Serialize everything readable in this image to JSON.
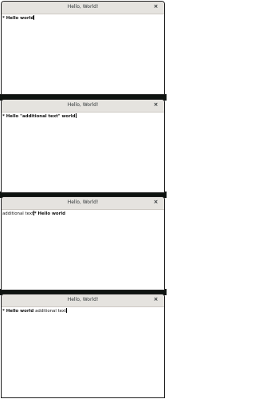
{
  "colors": {
    "titlebar": "#e5e3df",
    "desktop_background": "#0e1310",
    "window_border": "#1f1f1f",
    "text": "#111111"
  },
  "windows": [
    {
      "title": "Hello, World!",
      "close_glyph": "×",
      "text_segments": [
        {
          "text": "* Hello world",
          "bold": true
        }
      ],
      "caret_after_segment": 0
    },
    {
      "title": "Hello, World!",
      "close_glyph": "×",
      "text_segments": [
        {
          "text": "* Hello \"additional text\" world",
          "bold": true
        }
      ],
      "caret_after_segment": 0
    },
    {
      "title": "Hello, World!",
      "close_glyph": "×",
      "text_segments": [
        {
          "text": "additional text",
          "bold": false
        },
        {
          "text": "* Hello world",
          "bold": true
        }
      ],
      "caret_after_segment": 0
    },
    {
      "title": "Hello, World!",
      "close_glyph": "×",
      "text_segments": [
        {
          "text": "* Hello world ",
          "bold": true
        },
        {
          "text": "additional text",
          "bold": false
        }
      ],
      "caret_after_segment": 1
    }
  ]
}
